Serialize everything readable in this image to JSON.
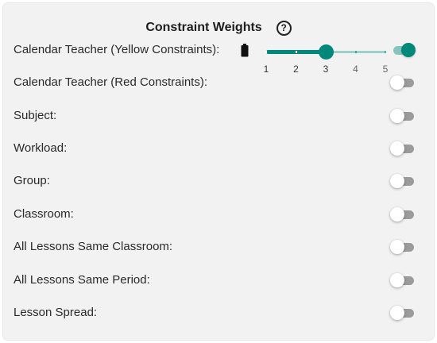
{
  "header": {
    "title": "Constraint Weights",
    "help_symbol": "?",
    "help_icon": "help-circle-icon"
  },
  "accent_color": "#00897b",
  "rows": [
    {
      "label": "Calendar Teacher (Yellow Constraints):",
      "enabled": true,
      "has_weight": true,
      "weight_icon": "battery-icon"
    },
    {
      "label": "Calendar Teacher (Red Constraints):",
      "enabled": false
    },
    {
      "label": "Subject:",
      "enabled": false
    },
    {
      "label": "Workload:",
      "enabled": false
    },
    {
      "label": "Group:",
      "enabled": false
    },
    {
      "label": "Classroom:",
      "enabled": false
    },
    {
      "label": "All Lessons Same Classroom:",
      "enabled": false
    },
    {
      "label": "All Lessons Same Period:",
      "enabled": false
    },
    {
      "label": "Lesson Spread:",
      "enabled": false
    }
  ],
  "weight_slider": {
    "min": 1,
    "max": 5,
    "value": 3,
    "marks": [
      "1",
      "2",
      "3",
      "4",
      "5"
    ]
  }
}
